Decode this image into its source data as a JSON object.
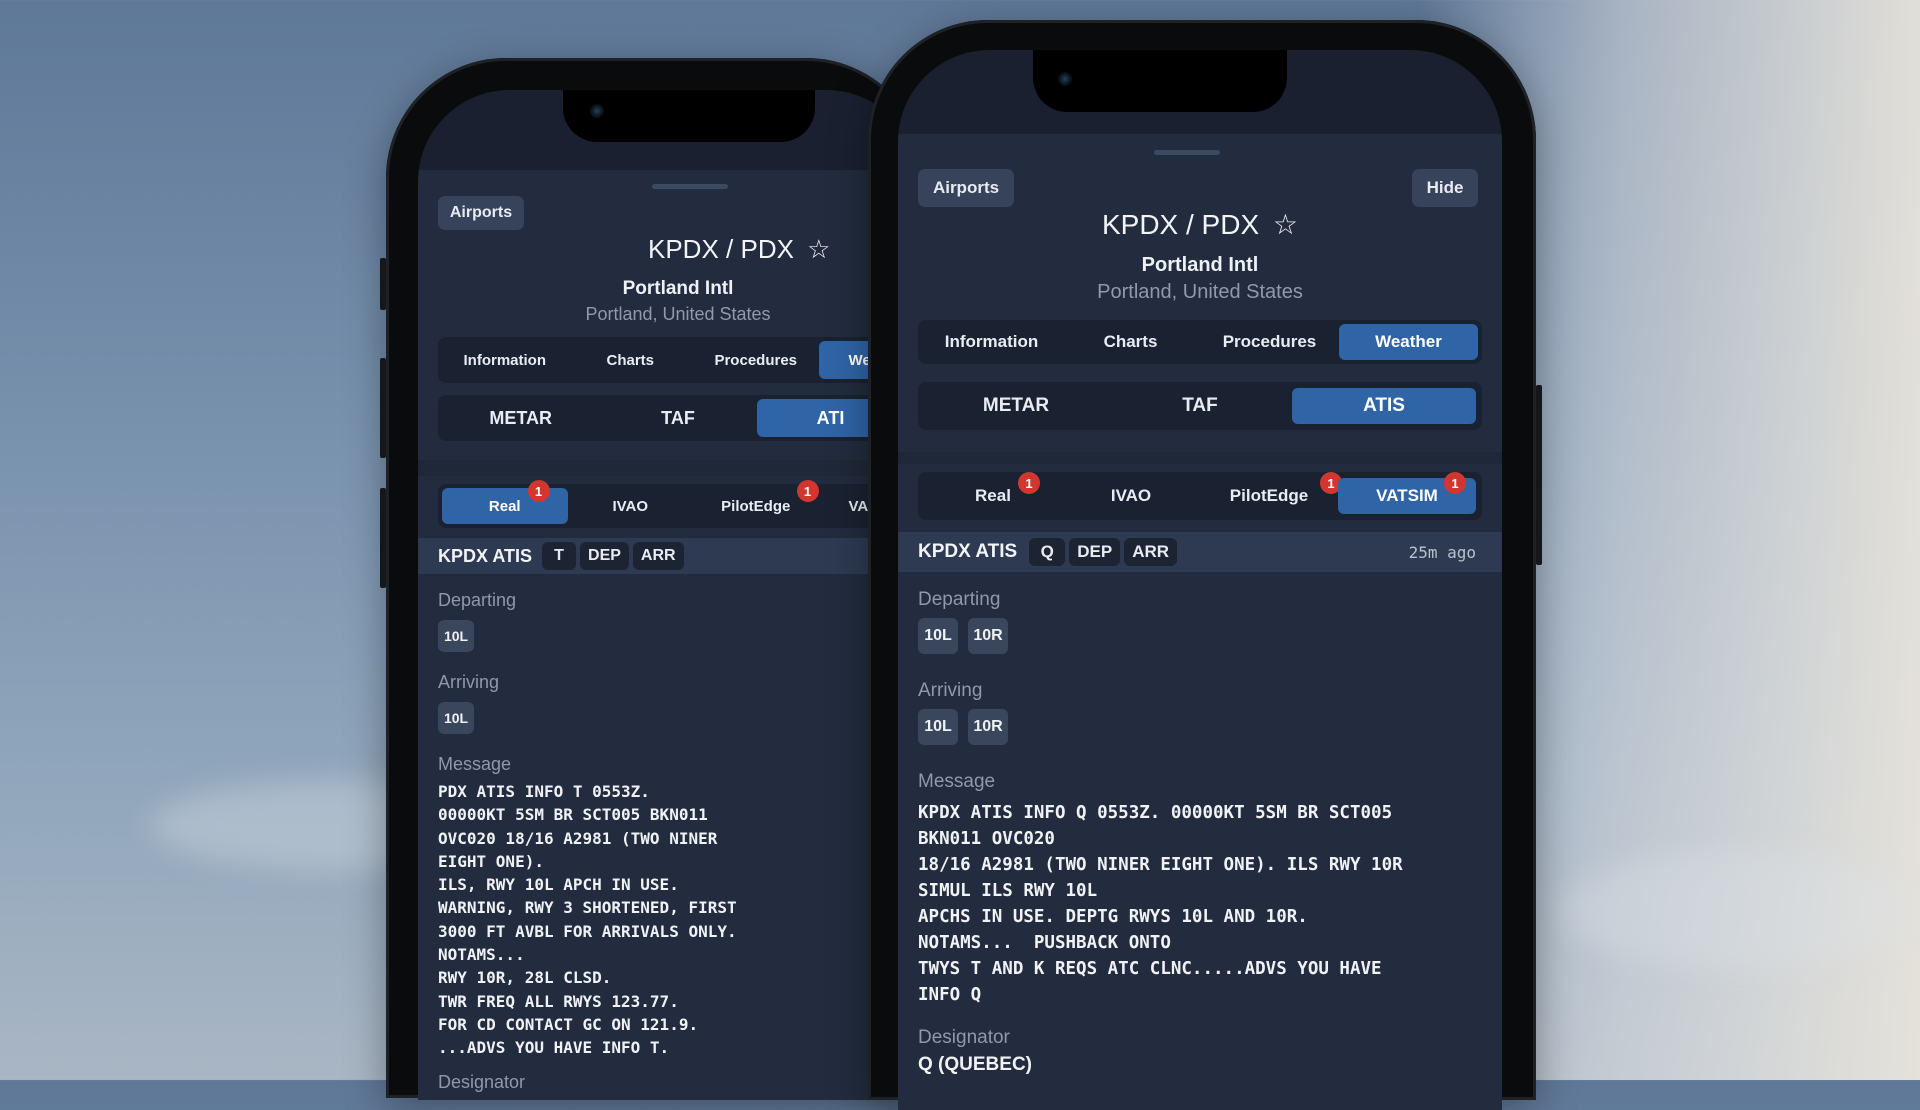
{
  "left_phone": {
    "airports_button": "Airports",
    "title": "KPDX / PDX",
    "star_icon": "☆",
    "airport_name": "Portland Intl",
    "location": "Portland, United States",
    "main_tabs": [
      {
        "label": "Information",
        "active": false
      },
      {
        "label": "Charts",
        "active": false
      },
      {
        "label": "Procedures",
        "active": false
      },
      {
        "label": "We",
        "active": true
      }
    ],
    "weather_tabs": [
      {
        "label": "METAR",
        "active": false
      },
      {
        "label": "TAF",
        "active": false
      },
      {
        "label": "ATI",
        "active": true
      }
    ],
    "sources": [
      {
        "label": "Real",
        "active": true,
        "badge": "1"
      },
      {
        "label": "IVAO",
        "active": false,
        "badge": null
      },
      {
        "label": "PilotEdge",
        "active": false,
        "badge": "1"
      },
      {
        "label": "VA",
        "active": false,
        "badge": null
      }
    ],
    "atis_header": {
      "name": "KPDX ATIS",
      "chips": [
        "T",
        "DEP",
        "ARR"
      ]
    },
    "departing_label": "Departing",
    "departing_runways": [
      "10L"
    ],
    "arriving_label": "Arriving",
    "arriving_runways": [
      "10L"
    ],
    "message_label": "Message",
    "message": "PDX ATIS INFO T 0553Z.\n00000KT 5SM BR SCT005 BKN011\nOVC020 18/16 A2981 (TWO NINER\nEIGHT ONE).\nILS, RWY 10L APCH IN USE.\nWARNING, RWY 3 SHORTENED, FIRST\n3000 FT AVBL FOR ARRIVALS ONLY.\nNOTAMS...\nRWY 10R, 28L CLSD.\nTWR FREQ ALL RWYS 123.77.\nFOR CD CONTACT GC ON 121.9.\n...ADVS YOU HAVE INFO T.",
    "designator_label": "Designator"
  },
  "right_phone": {
    "airports_button": "Airports",
    "hide_button": "Hide",
    "title": "KPDX / PDX",
    "star_icon": "☆",
    "airport_name": "Portland Intl",
    "location": "Portland, United States",
    "main_tabs": [
      {
        "label": "Information",
        "active": false
      },
      {
        "label": "Charts",
        "active": false
      },
      {
        "label": "Procedures",
        "active": false
      },
      {
        "label": "Weather",
        "active": true
      }
    ],
    "weather_tabs": [
      {
        "label": "METAR",
        "active": false
      },
      {
        "label": "TAF",
        "active": false
      },
      {
        "label": "ATIS",
        "active": true
      }
    ],
    "sources": [
      {
        "label": "Real",
        "active": false,
        "badge": "1"
      },
      {
        "label": "IVAO",
        "active": false,
        "badge": null
      },
      {
        "label": "PilotEdge",
        "active": false,
        "badge": "1"
      },
      {
        "label": "VATSIM",
        "active": true,
        "badge": "1"
      }
    ],
    "atis_header": {
      "name": "KPDX ATIS",
      "chips": [
        "Q",
        "DEP",
        "ARR"
      ],
      "age": "25m ago"
    },
    "departing_label": "Departing",
    "departing_runways": [
      "10L",
      "10R"
    ],
    "arriving_label": "Arriving",
    "arriving_runways": [
      "10L",
      "10R"
    ],
    "message_label": "Message",
    "message": "KPDX ATIS INFO Q 0553Z. 00000KT 5SM BR SCT005\nBKN011 OVC020\n18/16 A2981 (TWO NINER EIGHT ONE). ILS RWY 10R\nSIMUL ILS RWY 10L\nAPCHS IN USE. DEPTG RWYS 10L AND 10R.\nNOTAMS...  PUSHBACK ONTO\nTWYS T AND K REQS ATC CLNC.....ADVS YOU HAVE\nINFO Q",
    "designator_label": "Designator",
    "designator_value": "Q (QUEBEC)"
  },
  "colors": {
    "accent": "#2f64a7",
    "badge": "#d1372f",
    "sheet_bg": "#222c3e",
    "segment_bg": "#1a2231"
  }
}
